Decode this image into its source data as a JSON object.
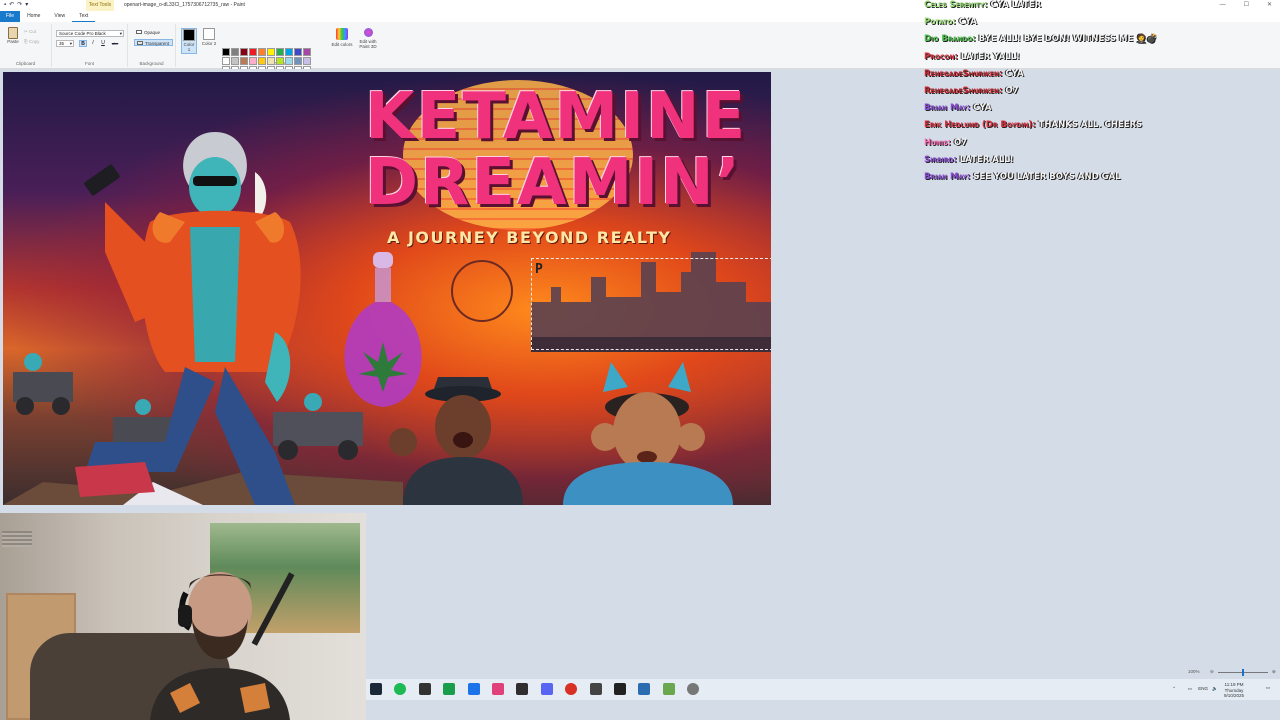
{
  "window": {
    "title": "openart-image_o-dL33Cl_1757306712735_raw - Paint",
    "context_tab": "Text Tools",
    "controls": [
      "—",
      "☐",
      "✕"
    ]
  },
  "menu": {
    "file": "File",
    "home": "Home",
    "view": "View",
    "text": "Text"
  },
  "ribbon": {
    "clipboard": {
      "paste": "Paste",
      "cut": "Cut",
      "copy": "Copy",
      "label": "Clipboard"
    },
    "font": {
      "family": "Source Code Pro Black",
      "size": "35",
      "bold": "B",
      "italic": "I",
      "underline": "U",
      "strike": "abc",
      "label": "Font"
    },
    "background": {
      "opaque": "Opaque",
      "transparent": "Transparent",
      "label": "Background"
    },
    "colors": {
      "color1_label": "Color 1",
      "color2_label": "Color 2",
      "edit_colors": "Edit colors",
      "paint3d": "Edit with Paint 3D",
      "label": "Colors",
      "color1": "#000000",
      "color2": "#ffffff",
      "palette": [
        "#000000",
        "#7f7f7f",
        "#880015",
        "#ed1c24",
        "#ff7f27",
        "#fff200",
        "#22b14c",
        "#00a2e8",
        "#3f48cc",
        "#a349a4",
        "#ffffff",
        "#c3c3c3",
        "#b97a57",
        "#ffaec9",
        "#ffc90e",
        "#efe4b0",
        "#b5e61d",
        "#99d9ea",
        "#7092be",
        "#c8bfe7",
        "#ffffff",
        "#ffffff",
        "#ffffff",
        "#ffffff",
        "#ffffff",
        "#ffffff",
        "#ffffff",
        "#ffffff",
        "#ffffff",
        "#ffffff"
      ]
    }
  },
  "artwork": {
    "title_line1": "KETAMINE",
    "title_line2": "DREAMIN’",
    "subtitle": "A JOURNEY BEYOND REALTY",
    "typed_text": "P"
  },
  "chat": [
    {
      "user": "Celes Serenity:",
      "msg": "CYA LATER",
      "color": "#8fd46b"
    },
    {
      "user": "Potato:",
      "msg": "CYA",
      "color": "#9ee07a"
    },
    {
      "user": "Dio Brando:",
      "msg": "BYE ALL! BYE DON! WITNESS ME 🤵💣",
      "color": "#4cc04c"
    },
    {
      "user": "Procon:",
      "msg": "LATER YALL!",
      "color": "#d9313f"
    },
    {
      "user": "RenegadeShuriken:",
      "msg": "CYA",
      "color": "#c9262f"
    },
    {
      "user": "RenegadeShuriken:",
      "msg": "O7",
      "color": "#c9262f"
    },
    {
      "user": "Brian May:",
      "msg": "CYA",
      "color": "#8b4fd6"
    },
    {
      "user": "Erik Hedlund (Dr Boydin):",
      "msg": "THANKS ALL. CHEERS",
      "color": "#d9313f"
    },
    {
      "user": "Hunis:",
      "msg": "O7",
      "color": "#ff69b4"
    },
    {
      "user": "Sirbird:",
      "msg": "LATER ALL!",
      "color": "#8b4fd6"
    },
    {
      "user": "Brian May:",
      "msg": "SEE YOU LATER BOYS AND GAL",
      "color": "#8b4fd6"
    }
  ],
  "status": {
    "zoom": "100%"
  },
  "taskbar": {
    "icons": [
      "steam-icon",
      "spotify-icon",
      "app-icon",
      "edge-icon",
      "chrome-icon",
      "photos-icon",
      "obs-icon",
      "discord-icon",
      "record-icon",
      "app2-icon",
      "terminal-icon",
      "notepad-icon",
      "paint-icon",
      "settings-icon"
    ],
    "lang": "ENG",
    "time": "11:19 PM",
    "day": "Thursday",
    "date": "9/10/2025"
  }
}
